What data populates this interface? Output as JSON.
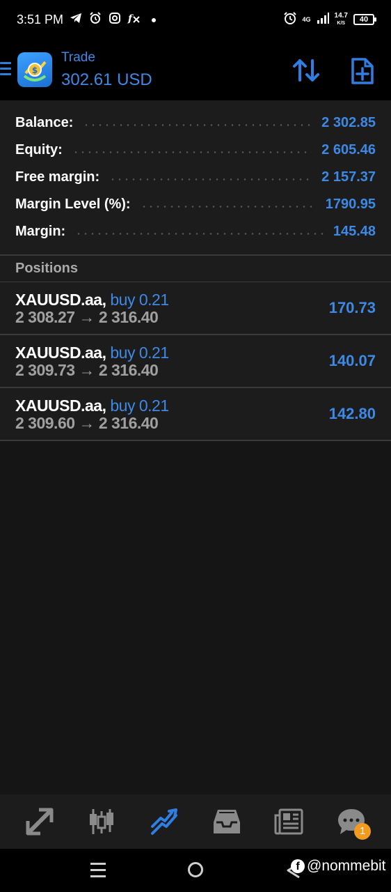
{
  "status_bar": {
    "time": "3:51 PM",
    "left_icons": [
      "telegram-icon",
      "alarm-icon",
      "instagram-icon",
      "fx-icon",
      "dot-icon"
    ],
    "network": "4G",
    "speed_value": "14.7",
    "speed_unit": "K/S",
    "battery": "40"
  },
  "header": {
    "title": "Trade",
    "subtitle": "302.61 USD",
    "accent_color": "#3d8ae6"
  },
  "summary": {
    "rows": [
      {
        "label": "Balance:",
        "value": "2 302.85"
      },
      {
        "label": "Equity:",
        "value": "2 605.46"
      },
      {
        "label": "Free margin:",
        "value": "2 157.37"
      },
      {
        "label": "Margin Level (%):",
        "value": "1790.95"
      },
      {
        "label": "Margin:",
        "value": "145.48"
      }
    ]
  },
  "positions": {
    "title": "Positions",
    "items": [
      {
        "symbol": "XAUUSD.aa,",
        "side": "buy 0.21",
        "open_price": "2 308.27",
        "arrow": "→",
        "current_price": "2 316.40",
        "profit": "170.73"
      },
      {
        "symbol": "XAUUSD.aa,",
        "side": "buy 0.21",
        "open_price": "2 309.73",
        "arrow": "→",
        "current_price": "2 316.40",
        "profit": "140.07"
      },
      {
        "symbol": "XAUUSD.aa,",
        "side": "buy 0.21",
        "open_price": "2 309.60",
        "arrow": "→",
        "current_price": "2 316.40",
        "profit": "142.80"
      }
    ]
  },
  "bottom_nav": {
    "items": [
      "quotes-icon",
      "chart-icon",
      "trade-icon",
      "history-icon",
      "news-icon",
      "messages-icon"
    ],
    "active": "trade-icon",
    "messages_badge": "1"
  },
  "watermark": {
    "text": "@nommebit"
  }
}
